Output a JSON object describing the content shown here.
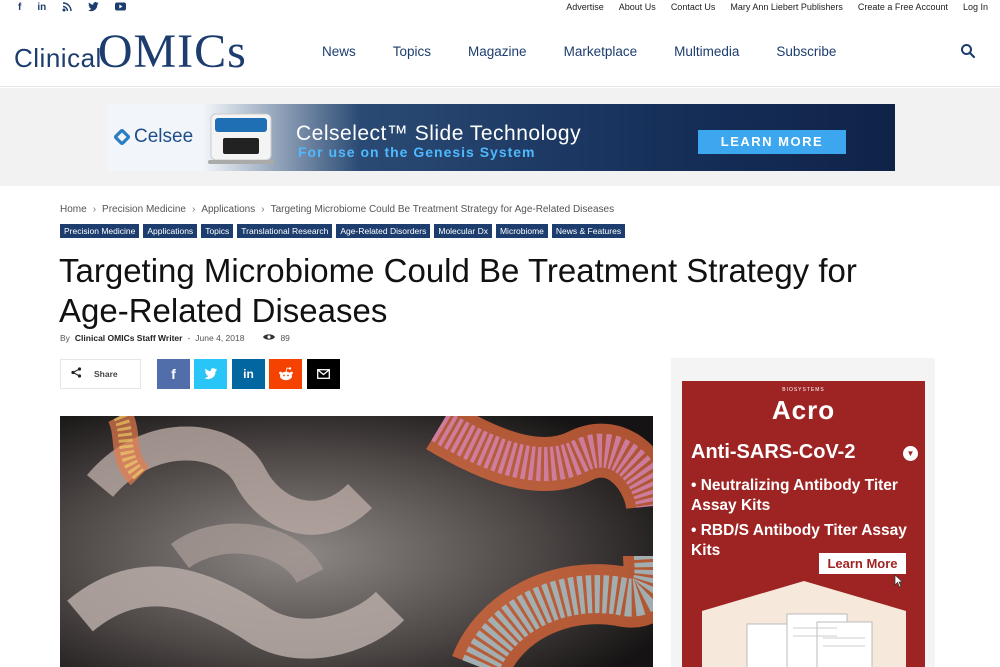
{
  "topbar": {
    "social": [
      "f",
      "in",
      "rss",
      "twitter",
      "yt"
    ],
    "links": [
      "Advertise",
      "About Us",
      "Contact Us",
      "Mary Ann Liebert Publishers",
      "Create a Free Account",
      "Log In"
    ]
  },
  "header": {
    "logo_part1": "Clinical",
    "logo_part2": "OMICs",
    "nav": [
      "News",
      "Topics",
      "Magazine",
      "Marketplace",
      "Multimedia",
      "Subscribe"
    ]
  },
  "banner": {
    "brand": "Celsee",
    "headline": "Celselect™ Slide Technology",
    "subline": "For use on the Genesis System",
    "cta": "LEARN MORE"
  },
  "breadcrumb": [
    "Home",
    "Precision Medicine",
    "Applications",
    "Targeting Microbiome Could Be Treatment Strategy for Age-Related Diseases"
  ],
  "tags": [
    "Precision Medicine",
    "Applications",
    "Topics",
    "Translational Research",
    "Age-Related Disorders",
    "Molecular Dx",
    "Microbiome",
    "News & Features"
  ],
  "article": {
    "title": "Targeting Microbiome Could Be Treatment Strategy for Age-Related Diseases",
    "by": "By",
    "author": "Clinical OMICs Staff Writer",
    "dash": "-",
    "date": "June 4, 2018",
    "views": "89"
  },
  "share": {
    "label": "Share",
    "buttons": [
      "facebook",
      "twitter",
      "linkedin",
      "reddit",
      "email"
    ]
  },
  "sidebar_ad": {
    "biosystems": "BIOSYSTEMS",
    "brand": "Acro",
    "product": "Anti-SARS-CoV-2",
    "bullet1": "• Neutralizing Antibody Titer Assay Kits",
    "bullet2": "• RBD/S Antibody Titer Assay Kits",
    "cta": "Learn More"
  },
  "colors": {
    "brand_navy": "#1c3d6e",
    "facebook": "#516eab",
    "twitter": "#29c5f6",
    "linkedin": "#0266a0",
    "reddit": "#f54200",
    "email": "#000000",
    "acro_red": "#9e2424"
  }
}
